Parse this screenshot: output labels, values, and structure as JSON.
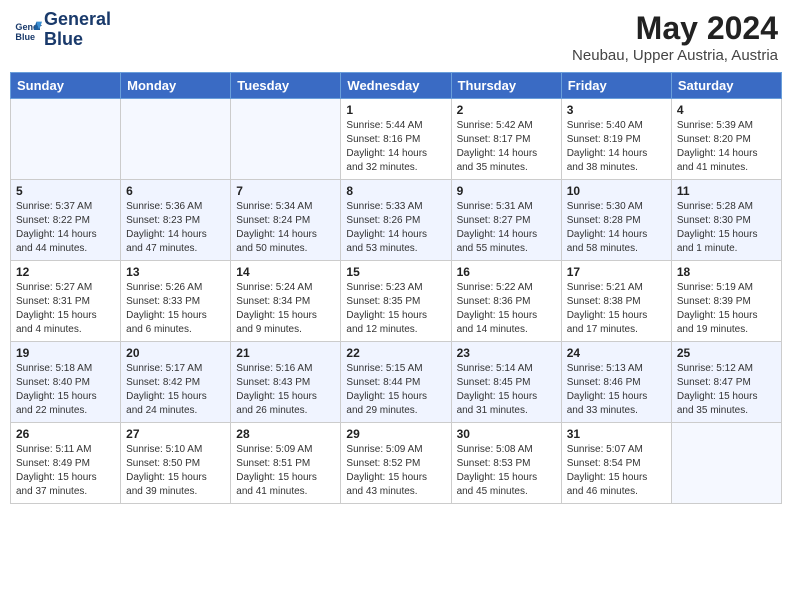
{
  "header": {
    "logo_line1": "General",
    "logo_line2": "Blue",
    "title": "May 2024",
    "subtitle": "Neubau, Upper Austria, Austria"
  },
  "days_of_week": [
    "Sunday",
    "Monday",
    "Tuesday",
    "Wednesday",
    "Thursday",
    "Friday",
    "Saturday"
  ],
  "weeks": [
    [
      {
        "day": "",
        "content": ""
      },
      {
        "day": "",
        "content": ""
      },
      {
        "day": "",
        "content": ""
      },
      {
        "day": "1",
        "content": "Sunrise: 5:44 AM\nSunset: 8:16 PM\nDaylight: 14 hours\nand 32 minutes."
      },
      {
        "day": "2",
        "content": "Sunrise: 5:42 AM\nSunset: 8:17 PM\nDaylight: 14 hours\nand 35 minutes."
      },
      {
        "day": "3",
        "content": "Sunrise: 5:40 AM\nSunset: 8:19 PM\nDaylight: 14 hours\nand 38 minutes."
      },
      {
        "day": "4",
        "content": "Sunrise: 5:39 AM\nSunset: 8:20 PM\nDaylight: 14 hours\nand 41 minutes."
      }
    ],
    [
      {
        "day": "5",
        "content": "Sunrise: 5:37 AM\nSunset: 8:22 PM\nDaylight: 14 hours\nand 44 minutes."
      },
      {
        "day": "6",
        "content": "Sunrise: 5:36 AM\nSunset: 8:23 PM\nDaylight: 14 hours\nand 47 minutes."
      },
      {
        "day": "7",
        "content": "Sunrise: 5:34 AM\nSunset: 8:24 PM\nDaylight: 14 hours\nand 50 minutes."
      },
      {
        "day": "8",
        "content": "Sunrise: 5:33 AM\nSunset: 8:26 PM\nDaylight: 14 hours\nand 53 minutes."
      },
      {
        "day": "9",
        "content": "Sunrise: 5:31 AM\nSunset: 8:27 PM\nDaylight: 14 hours\nand 55 minutes."
      },
      {
        "day": "10",
        "content": "Sunrise: 5:30 AM\nSunset: 8:28 PM\nDaylight: 14 hours\nand 58 minutes."
      },
      {
        "day": "11",
        "content": "Sunrise: 5:28 AM\nSunset: 8:30 PM\nDaylight: 15 hours\nand 1 minute."
      }
    ],
    [
      {
        "day": "12",
        "content": "Sunrise: 5:27 AM\nSunset: 8:31 PM\nDaylight: 15 hours\nand 4 minutes."
      },
      {
        "day": "13",
        "content": "Sunrise: 5:26 AM\nSunset: 8:33 PM\nDaylight: 15 hours\nand 6 minutes."
      },
      {
        "day": "14",
        "content": "Sunrise: 5:24 AM\nSunset: 8:34 PM\nDaylight: 15 hours\nand 9 minutes."
      },
      {
        "day": "15",
        "content": "Sunrise: 5:23 AM\nSunset: 8:35 PM\nDaylight: 15 hours\nand 12 minutes."
      },
      {
        "day": "16",
        "content": "Sunrise: 5:22 AM\nSunset: 8:36 PM\nDaylight: 15 hours\nand 14 minutes."
      },
      {
        "day": "17",
        "content": "Sunrise: 5:21 AM\nSunset: 8:38 PM\nDaylight: 15 hours\nand 17 minutes."
      },
      {
        "day": "18",
        "content": "Sunrise: 5:19 AM\nSunset: 8:39 PM\nDaylight: 15 hours\nand 19 minutes."
      }
    ],
    [
      {
        "day": "19",
        "content": "Sunrise: 5:18 AM\nSunset: 8:40 PM\nDaylight: 15 hours\nand 22 minutes."
      },
      {
        "day": "20",
        "content": "Sunrise: 5:17 AM\nSunset: 8:42 PM\nDaylight: 15 hours\nand 24 minutes."
      },
      {
        "day": "21",
        "content": "Sunrise: 5:16 AM\nSunset: 8:43 PM\nDaylight: 15 hours\nand 26 minutes."
      },
      {
        "day": "22",
        "content": "Sunrise: 5:15 AM\nSunset: 8:44 PM\nDaylight: 15 hours\nand 29 minutes."
      },
      {
        "day": "23",
        "content": "Sunrise: 5:14 AM\nSunset: 8:45 PM\nDaylight: 15 hours\nand 31 minutes."
      },
      {
        "day": "24",
        "content": "Sunrise: 5:13 AM\nSunset: 8:46 PM\nDaylight: 15 hours\nand 33 minutes."
      },
      {
        "day": "25",
        "content": "Sunrise: 5:12 AM\nSunset: 8:47 PM\nDaylight: 15 hours\nand 35 minutes."
      }
    ],
    [
      {
        "day": "26",
        "content": "Sunrise: 5:11 AM\nSunset: 8:49 PM\nDaylight: 15 hours\nand 37 minutes."
      },
      {
        "day": "27",
        "content": "Sunrise: 5:10 AM\nSunset: 8:50 PM\nDaylight: 15 hours\nand 39 minutes."
      },
      {
        "day": "28",
        "content": "Sunrise: 5:09 AM\nSunset: 8:51 PM\nDaylight: 15 hours\nand 41 minutes."
      },
      {
        "day": "29",
        "content": "Sunrise: 5:09 AM\nSunset: 8:52 PM\nDaylight: 15 hours\nand 43 minutes."
      },
      {
        "day": "30",
        "content": "Sunrise: 5:08 AM\nSunset: 8:53 PM\nDaylight: 15 hours\nand 45 minutes."
      },
      {
        "day": "31",
        "content": "Sunrise: 5:07 AM\nSunset: 8:54 PM\nDaylight: 15 hours\nand 46 minutes."
      },
      {
        "day": "",
        "content": ""
      }
    ]
  ]
}
